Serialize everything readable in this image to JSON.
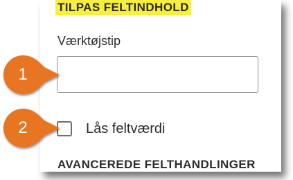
{
  "panel": {
    "section_title": "TILPAS FELTINDHOLD",
    "tooltip_label": "Værktøjstip",
    "tooltip_value": "",
    "lock_label": "Lås feltværdi",
    "lock_checked": false,
    "advanced_title": "AVANCEREDE FELTHANDLINGER"
  },
  "callouts": [
    {
      "number": "1",
      "icon": "orange-callout-circle"
    },
    {
      "number": "2",
      "icon": "orange-callout-circle"
    }
  ],
  "colors": {
    "highlight": "#f7ef3d",
    "callout": "#e87524",
    "text": "#2c2c2c"
  }
}
